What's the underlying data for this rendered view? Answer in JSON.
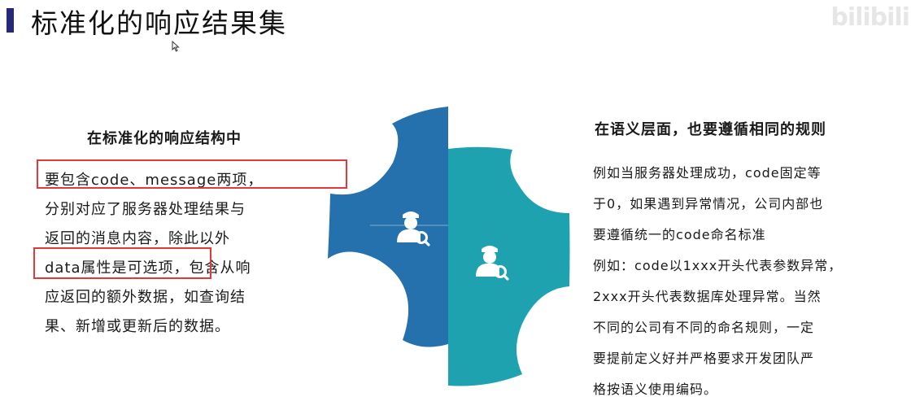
{
  "header": {
    "title": "标准化的响应结果集",
    "watermark": "bilibili"
  },
  "left": {
    "heading": "在标准化的响应结构中",
    "lines": [
      [
        "要包含",
        "code",
        "、",
        "message",
        "两项，"
      ],
      [
        "分别对应了服务器处理结果与"
      ],
      [
        "返回的消息内容，除此以外"
      ],
      [
        "data",
        "属性是可选项，包含从响"
      ],
      [
        "应返回的额外数据，如查询结"
      ],
      [
        "果、新增或更新后的数据。"
      ]
    ]
  },
  "right": {
    "heading": "在语义层面，也要遵循相同的规则",
    "lines": [
      [
        "例如当服务器处理成功，",
        "code",
        "固定等"
      ],
      [
        "于",
        "0",
        "，如果遇到异常情况，公司内部也"
      ],
      [
        "要遵循统一的",
        "code",
        "命名标准"
      ],
      [
        "例如：",
        "code",
        "以",
        "1xxx",
        "开头代表参数异常，"
      ],
      [
        "2xxx",
        "开头代表数据库处理异常。当然"
      ],
      [
        "不同的公司有不同的命名规则，一定"
      ],
      [
        "要提前定义好并严格要求开发团队严"
      ],
      [
        "格按语义使用编码。"
      ]
    ]
  },
  "colors": {
    "title_bar": "#26297a",
    "left_gear": "#2471ad",
    "right_gear": "#1fa2b0",
    "highlight": "#e03a3a"
  },
  "icons": [
    "user-search-icon",
    "user-search-icon"
  ]
}
